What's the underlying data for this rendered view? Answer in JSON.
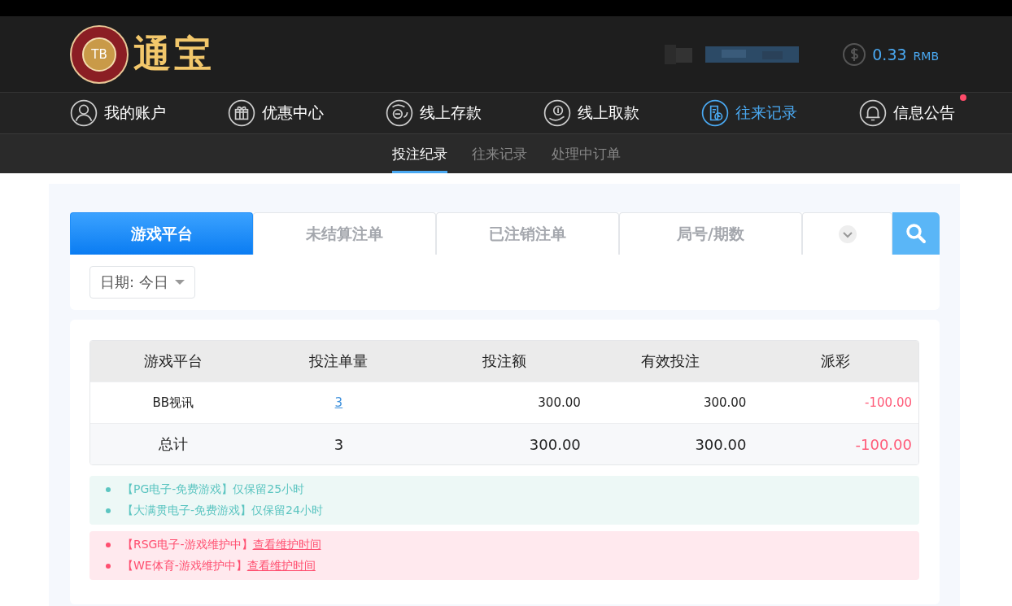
{
  "header": {
    "logo_badge": "TB",
    "logo_text": "通宝",
    "balance": "0.33",
    "currency": "RMB"
  },
  "nav": [
    {
      "label": "我的账户",
      "selected": false,
      "unread": false
    },
    {
      "label": "优惠中心",
      "selected": false,
      "unread": false
    },
    {
      "label": "线上存款",
      "selected": false,
      "unread": false
    },
    {
      "label": "线上取款",
      "selected": false,
      "unread": false
    },
    {
      "label": "往来记录",
      "selected": true,
      "unread": false
    },
    {
      "label": "信息公告",
      "selected": false,
      "unread": true
    }
  ],
  "subnav": [
    {
      "label": "投注纪录",
      "selected": true
    },
    {
      "label": "往来记录",
      "selected": false
    },
    {
      "label": "处理中订单",
      "selected": false
    }
  ],
  "filter_tabs": [
    {
      "label": "游戏平台",
      "selected": true
    },
    {
      "label": "未结算注单",
      "selected": false
    },
    {
      "label": "已注销注单",
      "selected": false
    },
    {
      "label": "局号/期数",
      "selected": false
    }
  ],
  "date_filter": "日期: 今日",
  "table": {
    "columns": [
      "游戏平台",
      "投注单量",
      "投注额",
      "有效投注",
      "派彩"
    ],
    "rows": [
      {
        "kind": "data",
        "cells": [
          "BB视讯",
          "3",
          "300.00",
          "300.00",
          "-100.00"
        ]
      },
      {
        "kind": "total",
        "cells": [
          "总计",
          "3",
          "300.00",
          "300.00",
          "-100.00"
        ]
      }
    ]
  },
  "notices": [
    {
      "kind": "info",
      "items": [
        {
          "text": "【PG电子-免费游戏】仅保留25小时"
        },
        {
          "text": "【大满贯电子-免费游戏】仅保留24小时"
        }
      ]
    },
    {
      "kind": "warning",
      "items": [
        {
          "text": "【RSG电子-游戏维护中】",
          "link": "查看维护时间"
        },
        {
          "text": "【WE体育-游戏维护中】",
          "link": "查看维护时间"
        }
      ]
    }
  ]
}
